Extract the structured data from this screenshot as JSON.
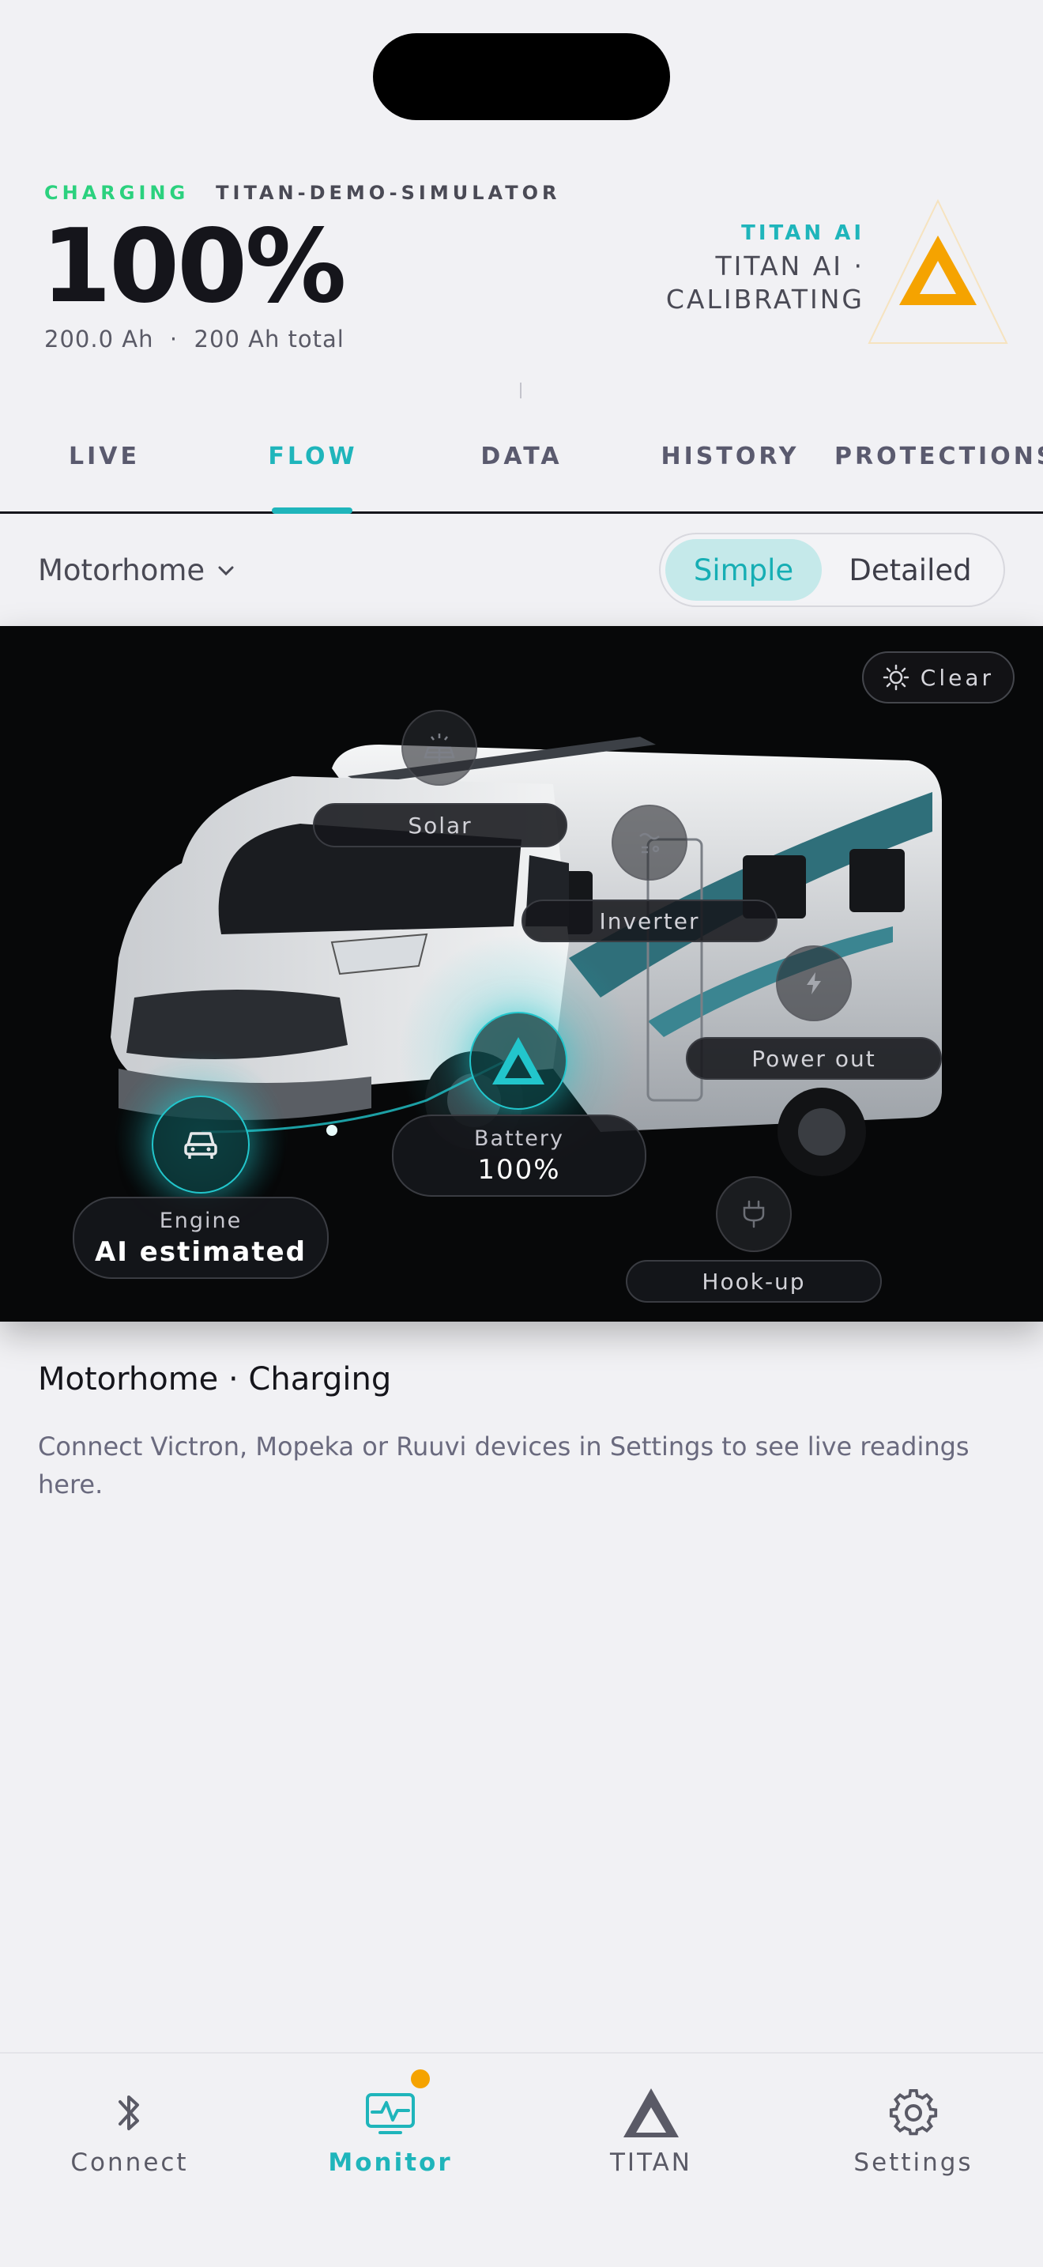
{
  "header": {
    "status": "CHARGING",
    "device": "TITAN-DEMO-SIMULATOR",
    "battery_percent": "100%",
    "capacity_text": "200.0 Ah  ·  200 Ah total",
    "ai_label": "TITAN AI",
    "ai_status": "TITAN AI · CALIBRATING",
    "ai_logo_icon": "titan-delta-icon",
    "ai_logo_color": "#f5a300"
  },
  "tabs": [
    {
      "label": "LIVE",
      "active": false
    },
    {
      "label": "FLOW",
      "active": true
    },
    {
      "label": "DATA",
      "active": false
    },
    {
      "label": "HISTORY",
      "active": false
    },
    {
      "label": "PROTECTIONS",
      "active": false
    }
  ],
  "vehicle_select": {
    "value": "Motorhome",
    "icon": "chevron-down-icon"
  },
  "view_toggle": {
    "options": [
      "Simple",
      "Detailed"
    ],
    "selected": "Simple"
  },
  "flow": {
    "weather": {
      "label": "Clear",
      "icon": "sun-icon"
    },
    "nodes": {
      "solar": {
        "label": "Solar",
        "icon": "solar-panel-icon"
      },
      "inverter": {
        "label": "Inverter",
        "icon": "inverter-icon"
      },
      "power_out": {
        "label": "Power out",
        "icon": "lightning-icon"
      },
      "battery": {
        "label": "Battery",
        "value": "100%",
        "icon": "titan-delta-icon"
      },
      "engine": {
        "label": "Engine",
        "value": "AI estimated",
        "icon": "car-icon"
      },
      "hookup": {
        "label": "Hook-up",
        "icon": "plug-icon"
      }
    },
    "accent_color": "#22c6cc"
  },
  "summary": {
    "title": "Motorhome · Charging",
    "body": "Connect Victron, Mopeka or Ruuvi devices in Settings to see live readings here."
  },
  "nav": [
    {
      "label": "Connect",
      "icon": "bluetooth-icon",
      "active": false
    },
    {
      "label": "Monitor",
      "icon": "monitor-icon",
      "active": true,
      "badge": true
    },
    {
      "label": "TITAN",
      "icon": "titan-delta-icon",
      "active": false
    },
    {
      "label": "Settings",
      "icon": "gear-icon",
      "active": false
    }
  ]
}
